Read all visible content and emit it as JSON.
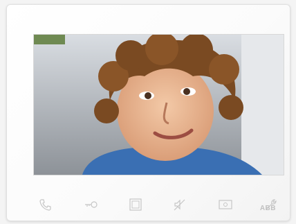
{
  "device": {
    "brand": "ABB",
    "accent_color": "#d8d8d8"
  },
  "video_feed": {
    "subject": "child-portrait"
  },
  "controls": [
    {
      "name": "call-button",
      "icon": "phone-icon"
    },
    {
      "name": "door-release-button",
      "icon": "key-icon"
    },
    {
      "name": "menu-button",
      "icon": "square-icon"
    },
    {
      "name": "mute-button",
      "icon": "mute-icon"
    },
    {
      "name": "monitor-button",
      "icon": "screen-icon"
    },
    {
      "name": "settings-button",
      "icon": "wrench-icon"
    }
  ]
}
